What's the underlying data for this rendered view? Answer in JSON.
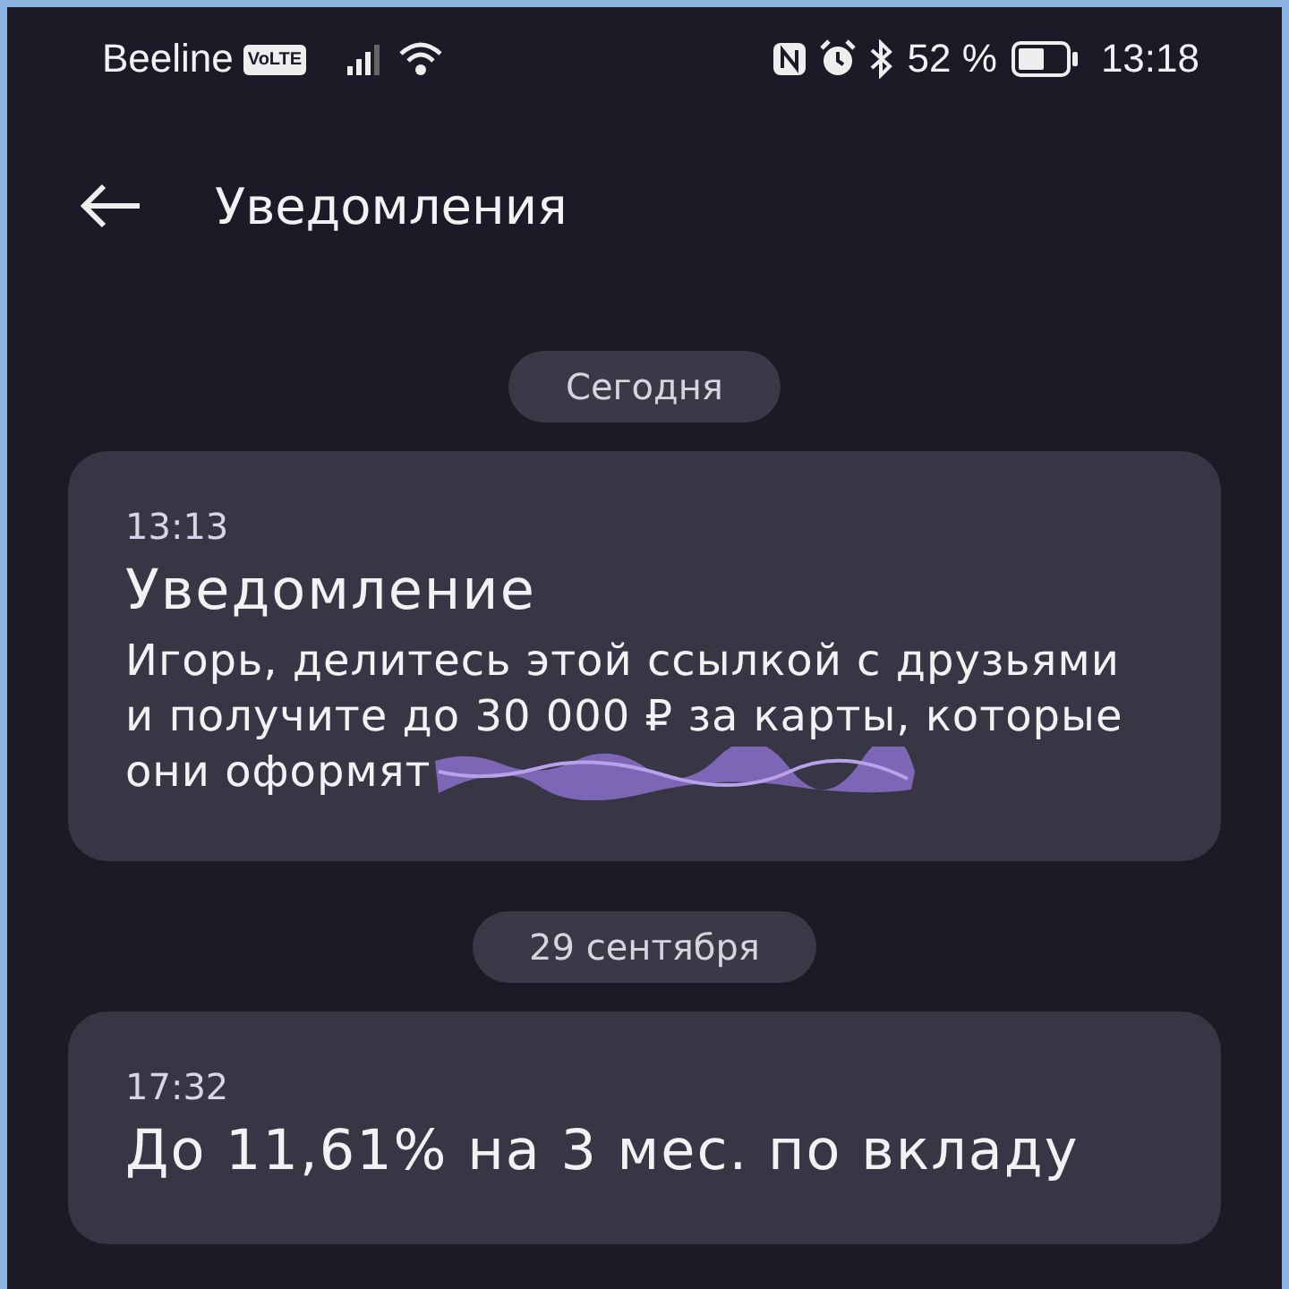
{
  "status_bar": {
    "carrier": "Beeline",
    "volte": "VoLTE",
    "battery_percent": "52 %",
    "time": "13:18"
  },
  "header": {
    "title": "Уведомления"
  },
  "groups": [
    {
      "date": "Сегодня",
      "notifications": [
        {
          "time": "13:13",
          "title": "Уведомление",
          "body": "Игорь, делитесь этой ссылкой с друзьями и получите до 30 000 ₽ за карты, которые они оформят",
          "redacted_link": true
        }
      ]
    },
    {
      "date": "29 сентября",
      "notifications": [
        {
          "time": "17:32",
          "title": "До 11,61% на 3 мес. по вкладу"
        }
      ]
    }
  ]
}
